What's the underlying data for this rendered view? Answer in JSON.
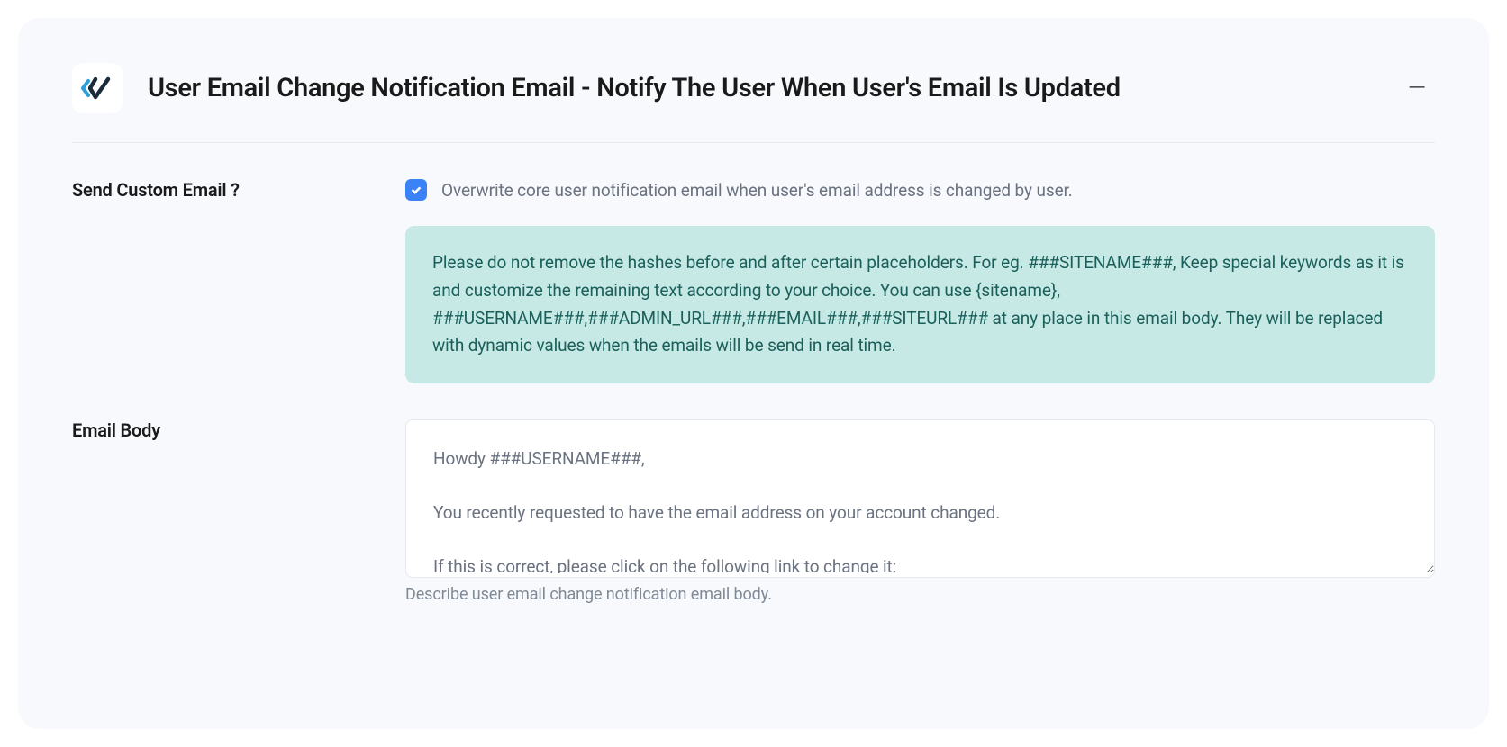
{
  "panel": {
    "title": "User Email Change Notification Email - Notify The User When User's Email Is Updated"
  },
  "form": {
    "send_custom_email": {
      "label": "Send Custom Email ?",
      "checked": true,
      "description": "Overwrite core user notification email when user's email address is changed by user."
    },
    "info_box": "Please do not remove the hashes before and after certain placeholders. For eg. ###SITENAME###, Keep special keywords as it is and customize the remaining text according to your choice. You can use {sitename}, ###USERNAME###,###ADMIN_URL###,###EMAIL###,###SITEURL### at any place in this email body. They will be replaced with dynamic values when the emails will be send in real time.",
    "email_body": {
      "label": "Email Body",
      "value": "Howdy ###USERNAME###,\n\nYou recently requested to have the email address on your account changed.\n\nIf this is correct, please click on the following link to change it:\n###ADMIN_URL###",
      "helper": "Describe user email change notification email body."
    }
  }
}
